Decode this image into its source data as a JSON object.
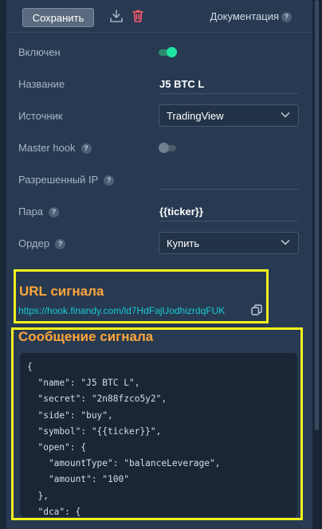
{
  "toolbar": {
    "save_label": "Сохранить",
    "doc_label": "Документация",
    "help_mark": "?"
  },
  "form": {
    "enabled_label": "Включен",
    "name_label": "Название",
    "name_value": "J5 BTC L",
    "source_label": "Источник",
    "source_value": "TradingView",
    "master_hook_label": "Master hook",
    "allowed_ip_label": "Разрешенный IP",
    "pair_label": "Пара",
    "pair_value": "{{ticker}}",
    "order_label": "Ордер",
    "order_value": "Купить",
    "help_mark": "?"
  },
  "signal": {
    "url_title": "URL сигнала",
    "url_value": "https://hook.finandy.com/ld7HdFajUodhizrdqFUK",
    "message_title": "Сообщение сигнала",
    "message_code": "{\n  \"name\": \"J5 BTC L\",\n  \"secret\": \"2n88fzco5y2\",\n  \"side\": \"buy\",\n  \"symbol\": \"{{ticker}}\",\n  \"open\": {\n    \"amountType\": \"balanceLeverage\",\n    \"amount\": \"100\"\n  },\n  \"dca\": {\n    \"amountType\": \"balanceLeverage\","
  },
  "colors": {
    "panel": "#273a52",
    "accent_green": "#1ee5a2",
    "link": "#19c9d4",
    "highlight": "#f2f21d",
    "title_orange": "#ffa53a"
  }
}
